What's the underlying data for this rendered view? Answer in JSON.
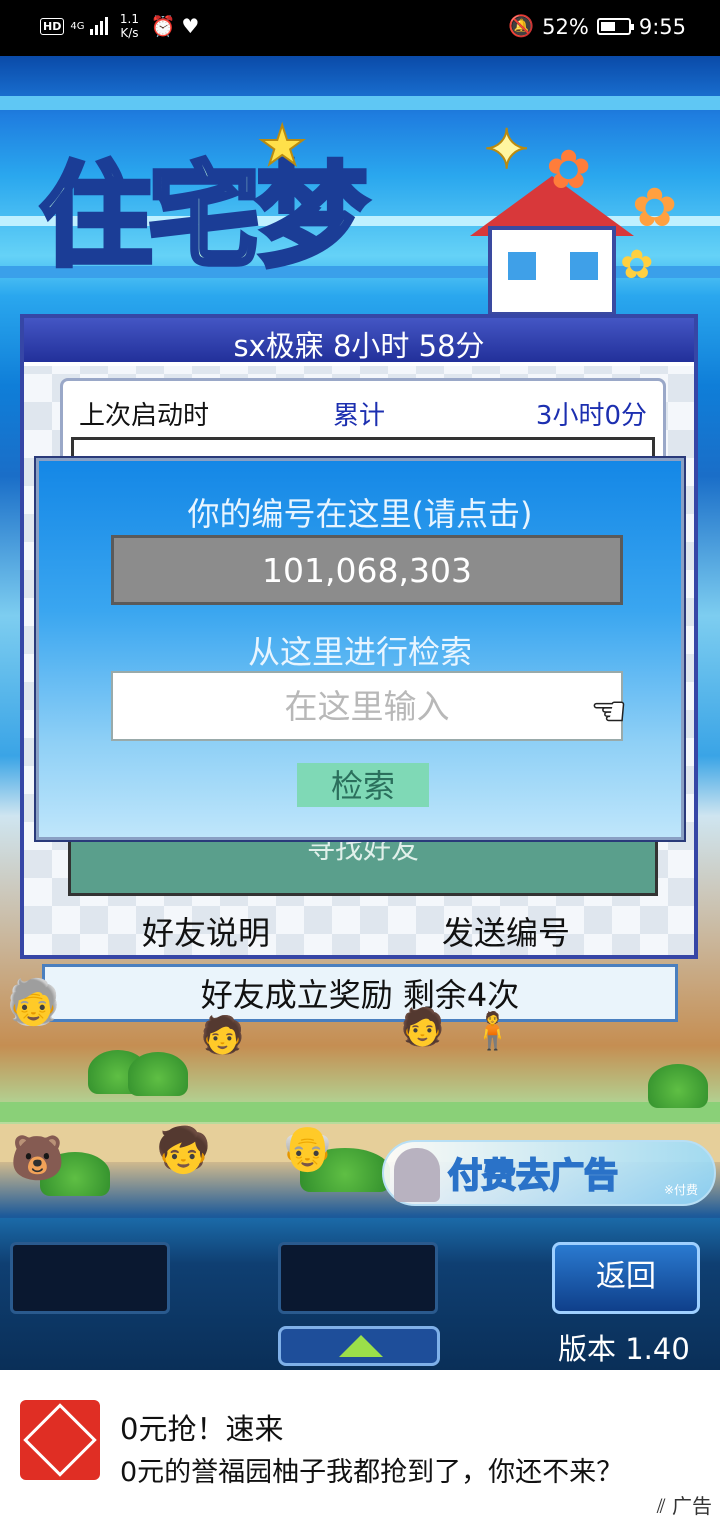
{
  "status_bar": {
    "hd": "HD",
    "network": "4G",
    "speed": "1.1 K/s",
    "alarm_icon": "alarm-clock-icon",
    "health_icon": "heart-rate-icon",
    "mute_icon": "mute-icon",
    "battery": "52%",
    "battery_level": 0.52,
    "time": "9:55"
  },
  "game": {
    "logo": "住宅梦",
    "panel": {
      "title": "sx极寐  8小时 58分",
      "last_launch_label": "上次启动时",
      "cumulative_label": "累计",
      "cumulative_value": "3小时0分",
      "find_friend_button": "寻找好友",
      "friend_info_button": "好友说明",
      "send_id_button": "发送编号"
    },
    "modal": {
      "id_header": "你的编号在这里(请点击)",
      "id_value": "101,068,303",
      "search_header": "从这里进行检索",
      "search_placeholder": "在这里输入",
      "search_button": "检索"
    },
    "bonus_bar": "好友成立奖励  剩余4次",
    "remove_ads": {
      "label": "付费去广告",
      "note": "※付费"
    },
    "controls": {
      "back_button": "返回",
      "version": "版本 1.40"
    }
  },
  "ad_banner": {
    "title": "0元抢！速来",
    "description": "0元的誉福园柚子我都抢到了，你还不来？",
    "tag": "广告"
  }
}
